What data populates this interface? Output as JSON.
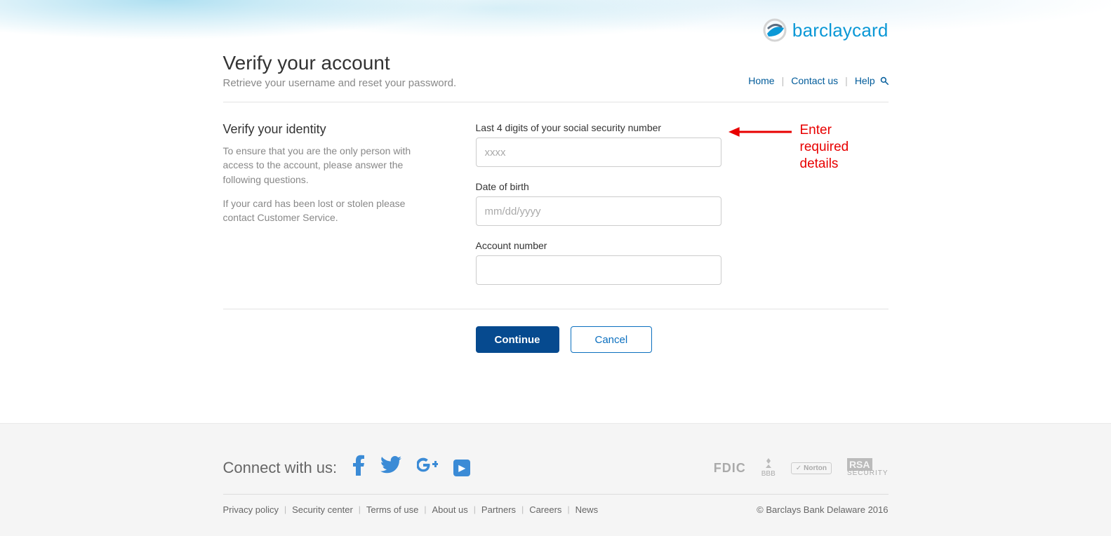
{
  "brand": {
    "name": "barclaycard"
  },
  "nav": {
    "home": "Home",
    "contact": "Contact us",
    "help": "Help"
  },
  "header": {
    "title": "Verify your account",
    "subtitle": "Retrieve your username and reset your password."
  },
  "verify": {
    "title": "Verify your identity",
    "p1": "To ensure that you are the only person with access to the account, please answer the following questions.",
    "p2": "If your card has been lost or stolen please contact Customer Service."
  },
  "form": {
    "ssn_label": "Last 4 digits of your social security number",
    "ssn_placeholder": "xxxx",
    "dob_label": "Date of birth",
    "dob_placeholder": "mm/dd/yyyy",
    "account_label": "Account number",
    "continue": "Continue",
    "cancel": "Cancel"
  },
  "annotation": "Enter required\ndetails",
  "footer": {
    "connect": "Connect with us:",
    "links": [
      "Privacy policy",
      "Security center",
      "Terms of use",
      "About us",
      "Partners",
      "Careers",
      "News"
    ],
    "badges": {
      "fdic": "FDIC",
      "bbb": "BBB",
      "norton": "Norton",
      "rsa": "RSA",
      "rsa2": "SECURITY"
    },
    "copyright": "© Barclays Bank Delaware 2016"
  }
}
